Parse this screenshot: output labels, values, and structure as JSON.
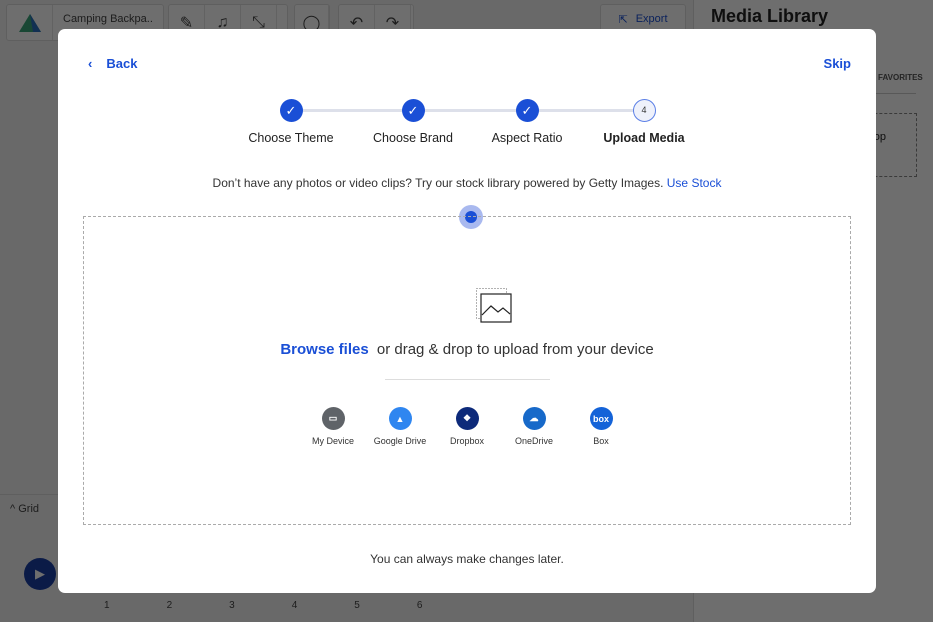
{
  "background": {
    "project_name": "Camping Backpa..",
    "export_label": "Export",
    "panel_title": "Media Library",
    "favorites_tab": "FAVORITES",
    "drop_text": "rop",
    "grid_label": "Grid",
    "thumbnails": [
      "1",
      "2",
      "3",
      "4",
      "5",
      "6"
    ]
  },
  "modal": {
    "back_label": "Back",
    "skip_label": "Skip",
    "steps": [
      {
        "label": "Choose Theme",
        "state": "done"
      },
      {
        "label": "Choose Brand",
        "state": "done"
      },
      {
        "label": "Aspect Ratio",
        "state": "done"
      },
      {
        "label": "Upload Media",
        "state": "current",
        "number": "4"
      }
    ],
    "stock_text": "Don’t have any photos or video clips? Try our stock library powered by Getty Images.",
    "stock_link": "Use Stock",
    "browse_link": "Browse files",
    "browse_text": "or drag & drop to upload from your device",
    "sources": [
      {
        "label": "My Device",
        "icon": "folder-icon",
        "color": "#5f6368"
      },
      {
        "label": "Google Drive",
        "icon": "google-drive-icon",
        "color": "#2f86f0"
      },
      {
        "label": "Dropbox",
        "icon": "dropbox-icon",
        "color": "#0d2a7a"
      },
      {
        "label": "OneDrive",
        "icon": "onedrive-icon",
        "color": "#1769c9"
      },
      {
        "label": "Box",
        "icon": "box-icon",
        "color": "#1463d8",
        "glyph": "box"
      }
    ],
    "footer_note": "You can always make changes later."
  },
  "colors": {
    "accent": "#1a4fd6",
    "overlay": "rgba(0,0,0,0.58)"
  }
}
